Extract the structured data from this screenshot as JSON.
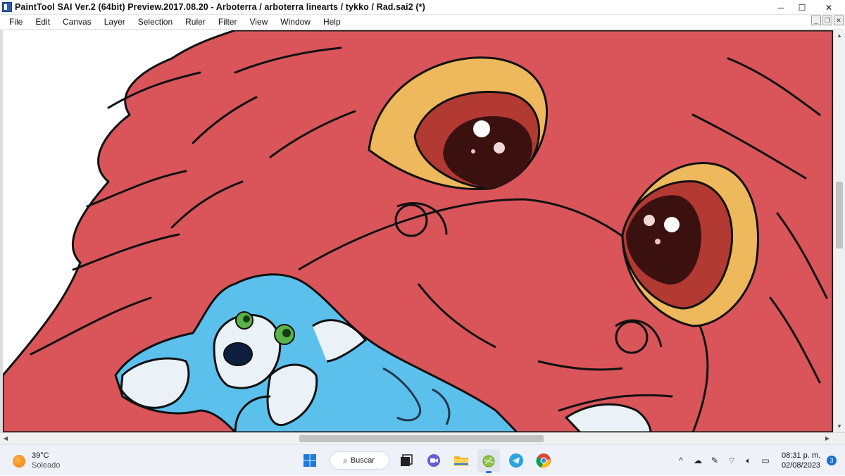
{
  "window": {
    "title": "PaintTool SAI Ver.2 (64bit) Preview.2017.08.20 - Arboterra / arboterra linearts / tykko / Rad.sai2 (*)",
    "minimize_glyph": "─",
    "maximize_glyph": "☐",
    "close_glyph": "✕"
  },
  "menu": {
    "items": [
      "File",
      "Edit",
      "Canvas",
      "Layer",
      "Selection",
      "Ruler",
      "Filter",
      "View",
      "Window",
      "Help"
    ],
    "child_controls": [
      "_",
      "❐",
      "✕"
    ]
  },
  "canvas": {
    "description_icons": [
      "red-dragon-artwork",
      "blue-pup-artwork"
    ],
    "colors": {
      "dragon": "#d9555a",
      "eye_yellow": "#eeb85c",
      "eye_red": "#b23a33",
      "pupil": "#3b1110",
      "pup_blue": "#5cc0ec",
      "pup_white": "#eaf2f8"
    }
  },
  "scrollbars": {
    "up": "▲",
    "down": "▼",
    "left": "◀",
    "right": "▶"
  },
  "taskbar": {
    "weather_temp": "39°C",
    "weather_desc": "Soleado",
    "search_label": "Buscar",
    "clock_time": "08:31 p. m.",
    "clock_date": "02/08/2023",
    "notification_count": "3"
  }
}
